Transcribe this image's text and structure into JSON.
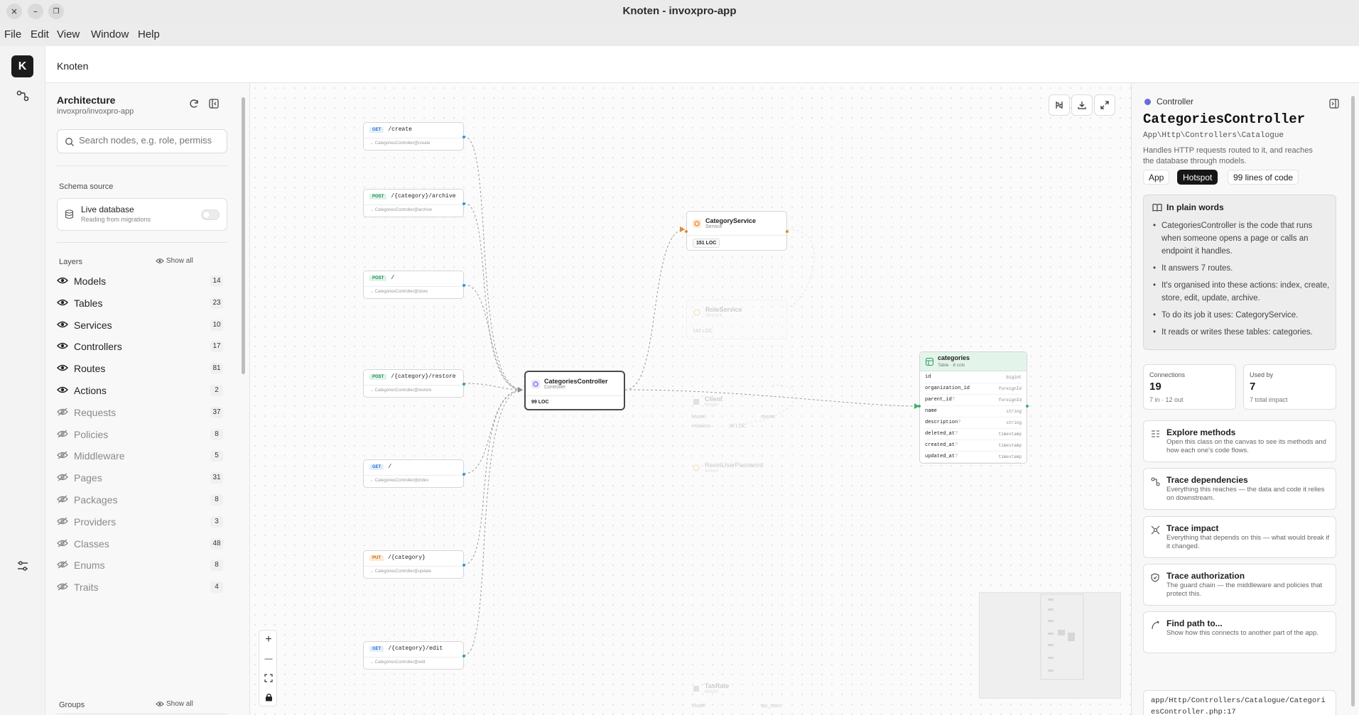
{
  "window": {
    "title": "Knoten - invoxpro-app",
    "close_icon": "×",
    "minimize_icon": "–",
    "maximize_icon": "❐"
  },
  "menu": [
    "File",
    "Edit",
    "View",
    "Window",
    "Help"
  ],
  "rail": {
    "logo": "K"
  },
  "topbar": {
    "title": "Knoten"
  },
  "left_panel": {
    "title": "Architecture",
    "subtitle": "invoxpro/invoxpro-app",
    "search_placeholder": "Search nodes, e.g. role, permiss",
    "schema_source_label": "Schema source",
    "schema_title": "Live database",
    "schema_sub": "Reading from migrations",
    "layers_label": "Layers",
    "show_all": "Show all",
    "groups_label": "Groups",
    "layers": [
      {
        "name": "Models",
        "count": "14",
        "visible": true
      },
      {
        "name": "Tables",
        "count": "23",
        "visible": true
      },
      {
        "name": "Services",
        "count": "10",
        "visible": true
      },
      {
        "name": "Controllers",
        "count": "17",
        "visible": true
      },
      {
        "name": "Routes",
        "count": "81",
        "visible": true
      },
      {
        "name": "Actions",
        "count": "2",
        "visible": true
      },
      {
        "name": "Requests",
        "count": "37",
        "visible": false
      },
      {
        "name": "Policies",
        "count": "8",
        "visible": false
      },
      {
        "name": "Middleware",
        "count": "5",
        "visible": false
      },
      {
        "name": "Pages",
        "count": "31",
        "visible": false
      },
      {
        "name": "Packages",
        "count": "8",
        "visible": false
      },
      {
        "name": "Providers",
        "count": "3",
        "visible": false
      },
      {
        "name": "Classes",
        "count": "48",
        "visible": false
      },
      {
        "name": "Enums",
        "count": "8",
        "visible": false
      },
      {
        "name": "Traits",
        "count": "4",
        "visible": false
      }
    ]
  },
  "canvas": {
    "routes": [
      {
        "method": "GET",
        "path": "/create",
        "handler": "→ CategoriesController@create"
      },
      {
        "method": "POST",
        "path": "/{category}/archive",
        "handler": "→ CategoriesController@archive"
      },
      {
        "method": "POST",
        "path": "/",
        "handler": "→ CategoriesController@store"
      },
      {
        "method": "POST",
        "path": "/{category}/restore",
        "handler": "→ CategoriesController@restore"
      },
      {
        "method": "GET",
        "path": "/",
        "handler": "→ CategoriesController@index"
      },
      {
        "method": "PUT",
        "path": "/{category}",
        "handler": "→ CategoriesController@update"
      },
      {
        "method": "GET",
        "path": "/{category}/edit",
        "handler": "→ CategoriesController@edit"
      }
    ],
    "controller": {
      "name": "CategoriesController",
      "type": "Controller",
      "loc": "99 LOC"
    },
    "service": {
      "name": "CategoryService",
      "type": "Service",
      "loc": "151 LOC"
    },
    "ghosts": {
      "role_service": {
        "name": "RoleService",
        "type": "Service",
        "loc": "142 LOC"
      },
      "client": {
        "name": "Client",
        "type": "Model",
        "a": "Model",
        "b": "clients",
        "c": "relations",
        "d": "38 LOC"
      },
      "reset_password": {
        "name": "ResetUserPassword",
        "type": "Action"
      },
      "tax_rate": {
        "name": "TaxRate",
        "type": "Model",
        "a": "Model",
        "b": "tax_rates"
      }
    },
    "table": {
      "name": "categories",
      "sub": "Table · 8 cols",
      "columns": [
        {
          "name": "id",
          "nullable": "",
          "type": "bigint"
        },
        {
          "name": "organization_id",
          "nullable": "",
          "type": "foreignId"
        },
        {
          "name": "parent_id",
          "nullable": "?",
          "type": "foreignId"
        },
        {
          "name": "name",
          "nullable": "",
          "type": "string"
        },
        {
          "name": "description",
          "nullable": "?",
          "type": "string"
        },
        {
          "name": "deleted_at",
          "nullable": "?",
          "type": "timestamp"
        },
        {
          "name": "created_at",
          "nullable": "?",
          "type": "timestamp"
        },
        {
          "name": "updated_at",
          "nullable": "?",
          "type": "timestamp"
        }
      ]
    },
    "zoom": {
      "in": "+",
      "out": "—"
    }
  },
  "right_panel": {
    "kind": "Controller",
    "name": "CategoriesController",
    "namespace": "App\\Http\\Controllers\\Catalogue",
    "description": "Handles HTTP requests routed to it, and reaches the database through models.",
    "tags": [
      "App",
      "Hotspot",
      "99 lines of code"
    ],
    "plain_title": "In plain words",
    "plain_points": [
      "CategoriesController is the code that runs when someone opens a page or calls an endpoint it handles.",
      "It answers 7 routes.",
      "It's organised into these actions: index, create, store, edit, update, archive.",
      "To do its job it uses: CategoryService.",
      "It reads or writes these tables: categories."
    ],
    "stats": [
      {
        "label": "Connections",
        "value": "19",
        "sub": "7 in · 12 out"
      },
      {
        "label": "Used by",
        "value": "7",
        "sub": "7 total impact"
      }
    ],
    "actions": [
      {
        "title": "Explore methods",
        "desc": "Open this class on the canvas to see its methods and how each one's code flows."
      },
      {
        "title": "Trace dependencies",
        "desc": "Everything this reaches — the data and code it relies on downstream."
      },
      {
        "title": "Trace impact",
        "desc": "Everything that depends on this — what would break if it changed."
      },
      {
        "title": "Trace authorization",
        "desc": "The guard chain — the middleware and policies that protect this."
      },
      {
        "title": "Find path to...",
        "desc": "Show how this connects to another part of the app."
      }
    ],
    "file_path": "app/Http/Controllers/Catalogue/CategoriesController.php:17"
  }
}
